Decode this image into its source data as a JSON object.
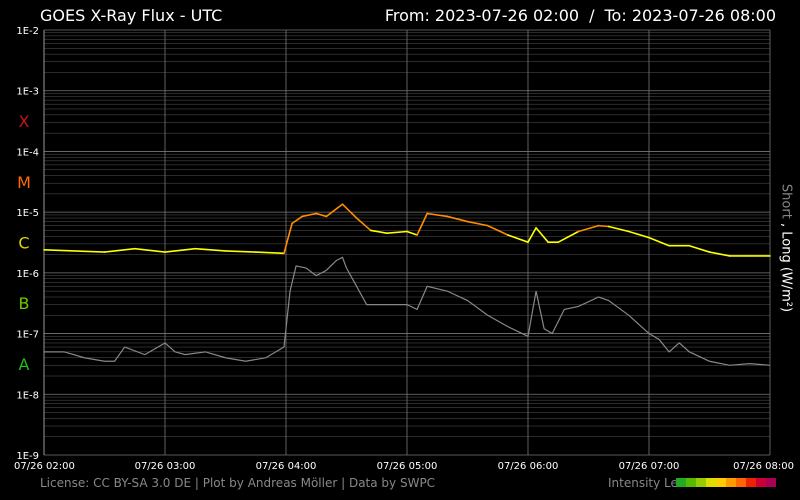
{
  "header": {
    "title": "GOES X-Ray Flux - UTC",
    "from_label": "From: 2023-07-26 02:00",
    "separator": "/",
    "to_label": "To: 2023-07-26 08:00"
  },
  "footer": {
    "license": "License: CC BY-SA 3.0 DE | Plot by Andreas Möller | Data by SWPC",
    "intensity_legend": "Intensity Legend"
  },
  "colors": {
    "background": "#000000",
    "grid": "#555555",
    "short_series": "#888888",
    "long_low": "#ffff00",
    "long_high": "#ff8c00",
    "class_X": "#c81414",
    "class_M": "#ff6a00",
    "class_C": "#d8d800",
    "class_B": "#66cc00",
    "class_A": "#22bb22",
    "intensity_scale": [
      "#22aa22",
      "#55bb00",
      "#99cc00",
      "#dddd00",
      "#ffcc00",
      "#ff9900",
      "#ff6600",
      "#ee2200",
      "#cc0033",
      "#aa0055"
    ]
  },
  "chart_data": {
    "type": "line",
    "ylabel_short": "Short",
    "ylabel_sep": ",",
    "ylabel_long": "Long (W/m²)",
    "y_scale": "log",
    "ylim": [
      1e-09,
      0.01
    ],
    "xlim": [
      "07/26 02:00",
      "07/26 08:00"
    ],
    "y_ticks": [
      "1E-2",
      "1E-3",
      "1E-4",
      "1E-5",
      "1E-6",
      "1E-7",
      "1E-8",
      "1E-9"
    ],
    "x_ticks": [
      "07/26 02:00",
      "07/26 03:00",
      "07/26 04:00",
      "07/26 05:00",
      "07/26 06:00",
      "07/26 07:00",
      "07/26 08:00"
    ],
    "flare_classes": [
      "X",
      "M",
      "C",
      "B",
      "A"
    ],
    "grid": true,
    "series": [
      {
        "key": "long",
        "x": [
          "02:00",
          "02:30",
          "02:45",
          "03:00",
          "03:15",
          "03:30",
          "03:45",
          "03:59",
          "04:03",
          "04:08",
          "04:15",
          "04:20",
          "04:28",
          "04:35",
          "04:42",
          "04:50",
          "05:00",
          "05:05",
          "05:10",
          "05:20",
          "05:30",
          "05:40",
          "05:50",
          "06:00",
          "06:04",
          "06:10",
          "06:15",
          "06:25",
          "06:35",
          "06:40",
          "06:50",
          "07:00",
          "07:10",
          "07:20",
          "07:30",
          "07:40",
          "07:50",
          "08:00"
        ],
        "y": [
          2.4e-06,
          2.2e-06,
          2.5e-06,
          2.2e-06,
          2.5e-06,
          2.3e-06,
          2.2e-06,
          2.1e-06,
          6.5e-06,
          8.5e-06,
          9.5e-06,
          8.5e-06,
          1.35e-05,
          8e-06,
          5e-06,
          4.5e-06,
          4.8e-06,
          4.2e-06,
          9.5e-06,
          8.5e-06,
          7e-06,
          6e-06,
          4.2e-06,
          3.2e-06,
          5.5e-06,
          3.2e-06,
          3.2e-06,
          4.8e-06,
          6e-06,
          5.8e-06,
          4.8e-06,
          3.8e-06,
          2.8e-06,
          2.8e-06,
          2.2e-06,
          1.9e-06,
          1.9e-06,
          1.9e-06
        ]
      },
      {
        "key": "short",
        "x": [
          "02:00",
          "02:10",
          "02:20",
          "02:30",
          "02:35",
          "02:40",
          "02:50",
          "03:00",
          "03:05",
          "03:10",
          "03:20",
          "03:30",
          "03:40",
          "03:50",
          "03:59",
          "04:02",
          "04:05",
          "04:10",
          "04:15",
          "04:20",
          "04:25",
          "04:28",
          "04:30",
          "04:35",
          "04:40",
          "04:50",
          "05:00",
          "05:05",
          "05:10",
          "05:20",
          "05:30",
          "05:40",
          "05:50",
          "06:00",
          "06:04",
          "06:08",
          "06:12",
          "06:18",
          "06:25",
          "06:35",
          "06:40",
          "06:50",
          "07:00",
          "07:05",
          "07:10",
          "07:15",
          "07:20",
          "07:30",
          "07:40",
          "07:50",
          "08:00"
        ],
        "y": [
          5e-08,
          5e-08,
          4e-08,
          3.5e-08,
          3.5e-08,
          6e-08,
          4.5e-08,
          7e-08,
          5e-08,
          4.5e-08,
          5e-08,
          4e-08,
          3.5e-08,
          4e-08,
          6e-08,
          5e-07,
          1.3e-06,
          1.2e-06,
          9e-07,
          1.1e-06,
          1.6e-06,
          1.8e-06,
          1.2e-06,
          6e-07,
          3e-07,
          3e-07,
          3e-07,
          2.5e-07,
          6e-07,
          5e-07,
          3.5e-07,
          2e-07,
          1.3e-07,
          9e-08,
          5e-07,
          1.2e-07,
          1e-07,
          2.5e-07,
          2.8e-07,
          4e-07,
          3.5e-07,
          2e-07,
          1e-07,
          8e-08,
          5e-08,
          7e-08,
          5e-08,
          3.5e-08,
          3e-08,
          3.2e-08,
          3e-08
        ]
      }
    ]
  }
}
